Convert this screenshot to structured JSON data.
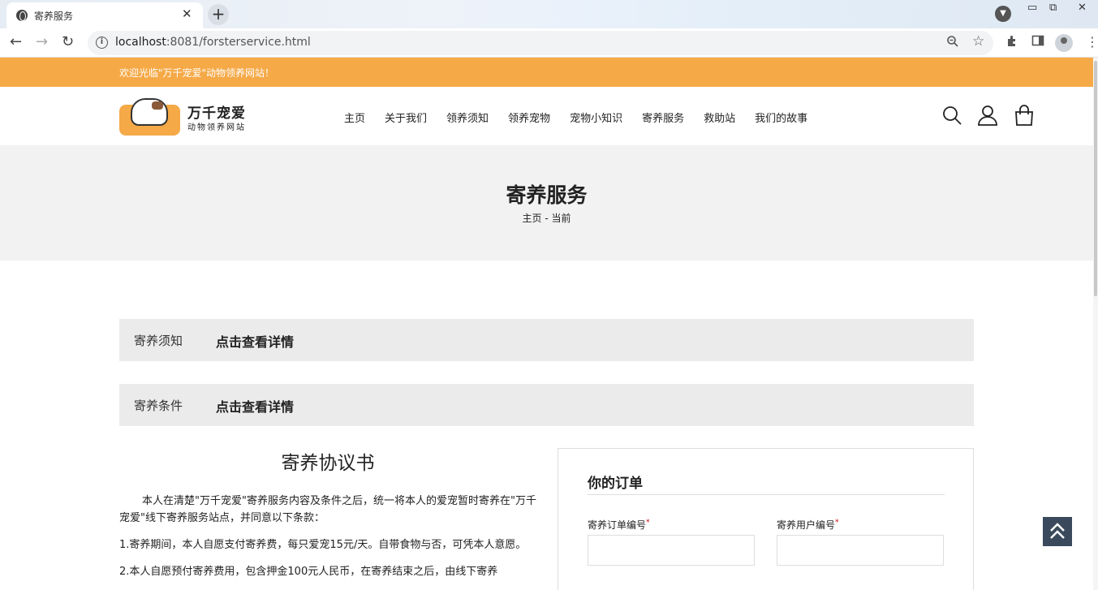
{
  "browser": {
    "tab_title": "寄养服务",
    "url_host": "localhost",
    "url_rest": ":8081/forsterservice.html"
  },
  "page": {
    "welcome": "欢迎光临\"万千宠爱\"动物领养网站！",
    "logo": {
      "title": "万千宠爱",
      "subtitle": "动物领养网站"
    },
    "nav": [
      "主页",
      "关于我们",
      "领养须知",
      "领养宠物",
      "宠物小知识",
      "寄养服务",
      "救助站",
      "我们的故事"
    ],
    "hero": {
      "title": "寄养服务",
      "crumb_home": "主页",
      "crumb_sep": "-",
      "crumb_current": "当前"
    },
    "accordions": [
      {
        "label": "寄养须知",
        "link": "点击查看详情"
      },
      {
        "label": "寄养条件",
        "link": "点击查看详情"
      }
    ],
    "agreement": {
      "title": "寄养协议书",
      "p1": "本人在清楚\"万千宠爱\"寄养服务内容及条件之后，统一将本人的爱宠暂时寄养在\"万千宠爱\"线下寄养服务站点，并同意以下条款：",
      "p2": "1.寄养期间，本人自愿支付寄养费，每只爱宠15元/天。自带食物与否，可凭本人意愿。",
      "p3": "2.本人自愿预付寄养费用，包含押金100元人民币，在寄养结束之后，由线下寄养"
    },
    "order": {
      "title": "你的订单",
      "field1_label": "寄养订单编号",
      "field2_label": "寄养用户编号",
      "required_mark": "*"
    }
  }
}
